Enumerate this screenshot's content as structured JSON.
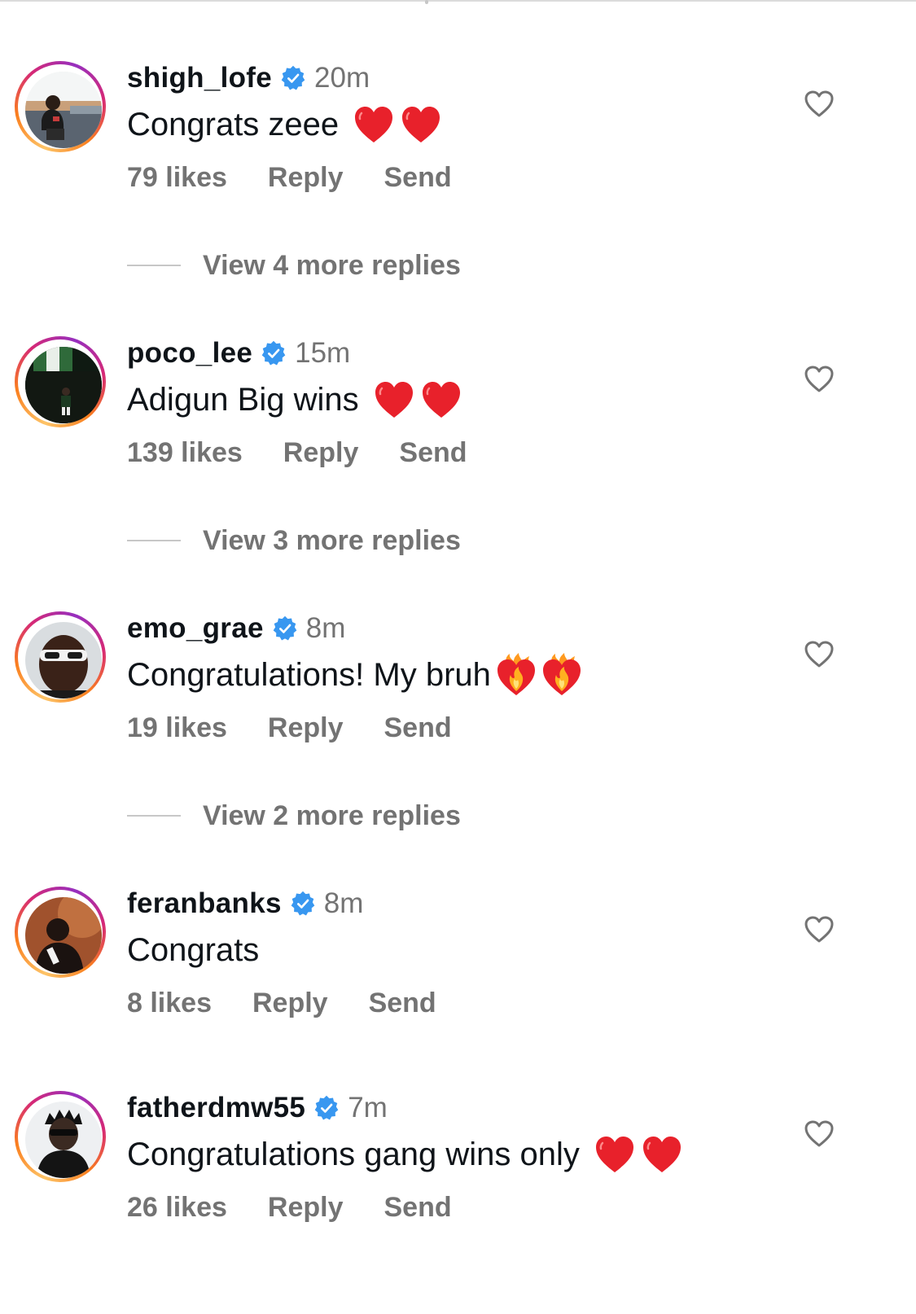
{
  "comments": [
    {
      "username": "shigh_lofe",
      "time": "20m",
      "text": "Congrats zeee",
      "emoji": "heart-heart",
      "likes": "79 likes",
      "reply": "Reply",
      "send": "Send",
      "view_replies": "View 4 more replies"
    },
    {
      "username": "poco_lee",
      "time": "15m",
      "text": "Adigun Big wins",
      "emoji": "heart-heart",
      "likes": "139 likes",
      "reply": "Reply",
      "send": "Send",
      "view_replies": "View 3 more replies"
    },
    {
      "username": "emo_grae",
      "time": "8m",
      "text": "Congratulations! My bruh",
      "emoji": "heart-on-fire-x2",
      "likes": "19 likes",
      "reply": "Reply",
      "send": "Send",
      "view_replies": "View 2 more replies"
    },
    {
      "username": "feranbanks",
      "time": "8m",
      "text": "Congrats",
      "emoji": "none",
      "likes": "8 likes",
      "reply": "Reply",
      "send": "Send"
    },
    {
      "username": "fatherdmw55",
      "time": "7m",
      "text": "Congratulations gang wins only",
      "emoji": "heart-heart",
      "likes": "26 likes",
      "reply": "Reply",
      "send": "Send"
    }
  ],
  "colors": {
    "verified": "#3897f0",
    "muted": "#737373",
    "text": "#0f1419",
    "emoji_heart": "#e8212b",
    "ring_gradient": [
      "#fdc468",
      "#fa7e1e",
      "#d62976",
      "#962fbf"
    ]
  },
  "icons": {
    "verified": "verified-badge-icon",
    "like": "heart-outline-icon",
    "emoji_heart": "red-heart-emoji",
    "emoji_fire": "heart-on-fire-emoji"
  }
}
